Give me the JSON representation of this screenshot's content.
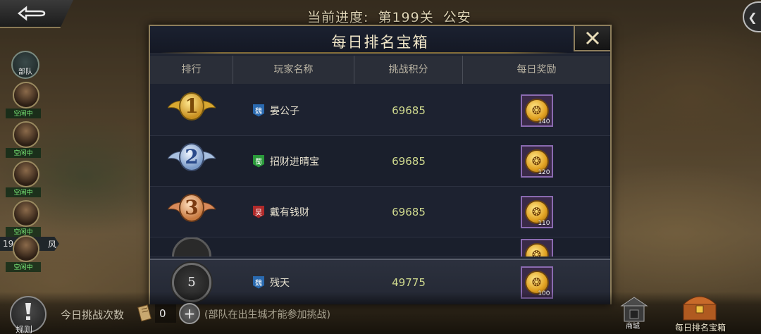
{
  "header": {
    "progress_prefix": "当前进度:",
    "progress_stage": "第199关",
    "progress_city": "公安"
  },
  "sidebar": {
    "troop_head_label": "部队",
    "troops": [
      {
        "status": "空闲中"
      },
      {
        "status": "空闲中"
      },
      {
        "status": "空闲中"
      },
      {
        "status": "空闲中"
      },
      {
        "status": "空闲中"
      }
    ],
    "troop_num_left": "19",
    "troop_num_right": "风"
  },
  "modal": {
    "title": "每日排名宝箱",
    "columns": [
      "排行",
      "玩家名称",
      "挑战积分",
      "每日奖励"
    ],
    "rows": [
      {
        "rank": "1",
        "faction": "魏",
        "faction_color": "#2a6ab0",
        "name": "晏公子",
        "score": "69685",
        "reward_qty": "140"
      },
      {
        "rank": "2",
        "faction": "蜀",
        "faction_color": "#2a9a3a",
        "name": "招财进晴宝",
        "score": "69685",
        "reward_qty": "120"
      },
      {
        "rank": "3",
        "faction": "吴",
        "faction_color": "#b02a2a",
        "name": "戴有钱财",
        "score": "69685",
        "reward_qty": "110"
      }
    ],
    "self_row": {
      "rank": "5",
      "faction": "魏",
      "faction_color": "#2a6ab0",
      "name": "残天",
      "score": "49775",
      "reward_qty": "100"
    }
  },
  "bottom": {
    "rules_label": "规则",
    "today_label": "今日挑战次数",
    "count": "0",
    "hint": "(部队在出生城才能参加挑战)",
    "shop_label": "商城",
    "chest_label": "每日排名宝箱"
  }
}
